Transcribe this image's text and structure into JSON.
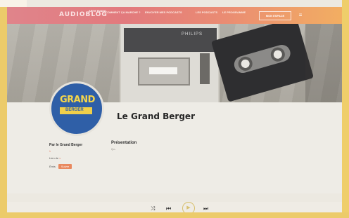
{
  "nav": {
    "brand": "AUDIOBLOG",
    "brand_mark": "ARTE RADIO",
    "items": [
      "Comment ça marche ?",
      "Envoyer mes podcasts",
      "Les podcasts",
      "Le programme"
    ],
    "cta": "MON ESPACE",
    "menu_glyph": "≡"
  },
  "hero": {
    "recorder_brand": "PHILIPS"
  },
  "profile": {
    "title": "Le Grand Berger",
    "avatar_text_1": "GRAND",
    "avatar_text_2": "BERGER"
  },
  "sidebar": {
    "by_label": "Par le Grand Berger",
    "by_sub": "lr",
    "since_label": "Lien de",
    "since_value": "s",
    "emissions_label": "Émis",
    "emissions_button": "Suivre"
  },
  "description": {
    "heading": "Présentation",
    "paragraphs": [
      "Qu...",
      "",
      "",
      "",
      "",
      "",
      ""
    ]
  },
  "player": {
    "shuffle_glyph": "⤨",
    "prev_glyph": "⏮",
    "play_glyph": "▶",
    "next_glyph": "⏭"
  },
  "colors": {
    "nav_gradient_start": "#e0848b",
    "nav_gradient_end": "#f2ae62",
    "frame_yellow": "#eccb6a",
    "accent_orange": "#e9895f",
    "avatar_blue": "#2f5fa7",
    "avatar_yellow": "#f6d64a"
  }
}
